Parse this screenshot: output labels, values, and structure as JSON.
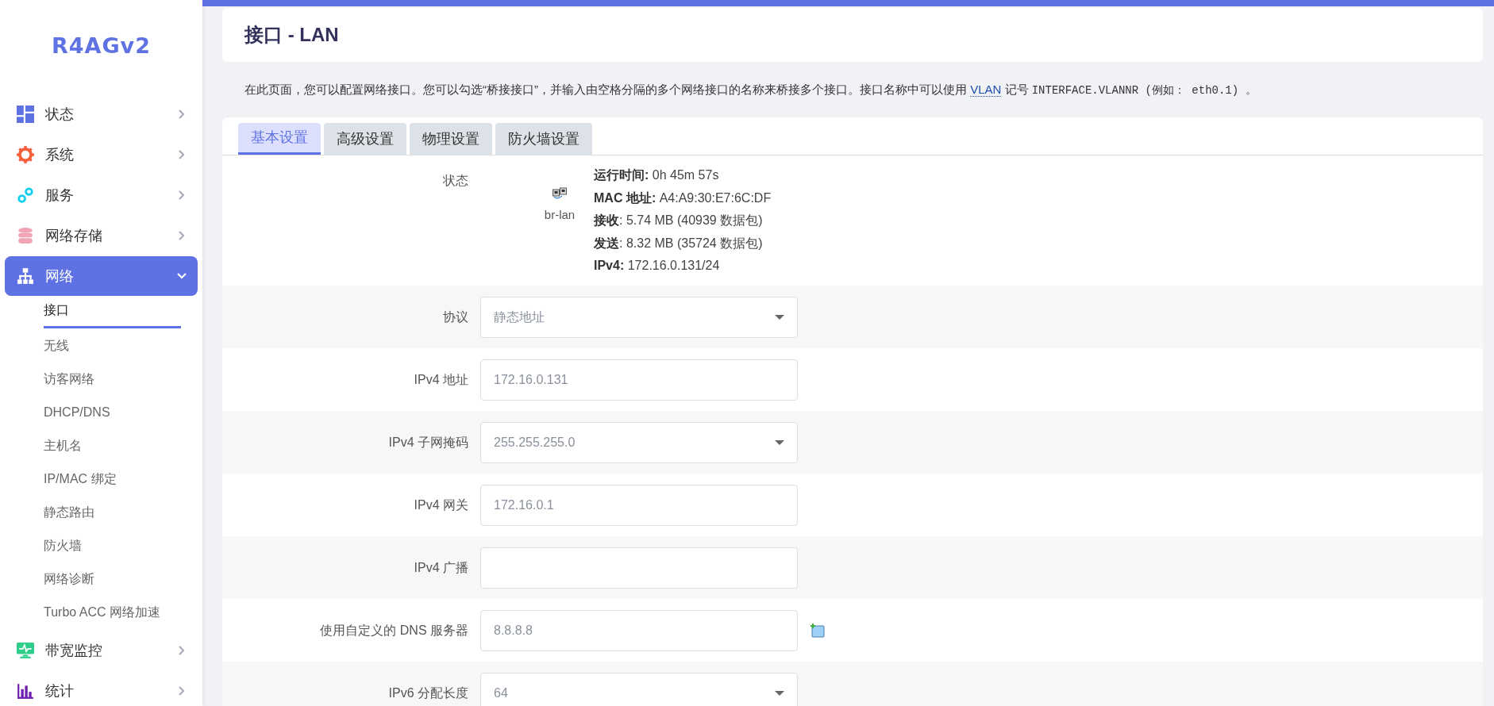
{
  "logo": "R4AGv2",
  "menu": [
    {
      "label": "状态",
      "selected": false,
      "expanded": false
    },
    {
      "label": "系统",
      "selected": false,
      "expanded": false
    },
    {
      "label": "服务",
      "selected": false,
      "expanded": false
    },
    {
      "label": "网络存储",
      "selected": false,
      "expanded": false
    },
    {
      "label": "网络",
      "selected": true,
      "expanded": true,
      "children": [
        {
          "label": "接口",
          "selected": true
        },
        {
          "label": "无线",
          "selected": false
        },
        {
          "label": "访客网络",
          "selected": false
        },
        {
          "label": "DHCP/DNS",
          "selected": false
        },
        {
          "label": "主机名",
          "selected": false
        },
        {
          "label": "IP/MAC 绑定",
          "selected": false
        },
        {
          "label": "静态路由",
          "selected": false
        },
        {
          "label": "防火墙",
          "selected": false
        },
        {
          "label": "网络诊断",
          "selected": false
        },
        {
          "label": "Turbo ACC 网络加速",
          "selected": false
        }
      ]
    },
    {
      "label": "带宽监控",
      "selected": false,
      "expanded": false
    },
    {
      "label": "统计",
      "selected": false,
      "expanded": false
    }
  ],
  "page_title": "接口 - LAN",
  "description": [
    {
      "kind": "plain",
      "text": "在此页面，您可以配置网络接口。您可以勾选“桥接接口”，并输入由空格分隔的多个网络接口的名称来桥接多个接口。接口名称中可以使用 "
    },
    {
      "kind": "abbr",
      "text": "VLAN"
    },
    {
      "kind": "plain",
      "text": " 记号 "
    },
    {
      "kind": "code",
      "text": "INTERFACE.VLANNR (例如： eth0.1) 。"
    }
  ],
  "tabs": [
    {
      "label": "基本设置",
      "selected": true
    },
    {
      "label": "高级设置",
      "selected": false
    },
    {
      "label": "物理设置",
      "selected": false
    },
    {
      "label": "防火墙设置",
      "selected": false
    }
  ],
  "status": {
    "label": "状态",
    "device": "br-lan",
    "lines": [
      "**运行时间:** 0h 45m 57s",
      "**MAC 地址:** A4:A9:30:E7:6C:DF",
      "**接收**: 5.74 MB (40939 数据包)",
      "**发送**: 8.32 MB (35724 数据包)",
      "**IPv4:** 172.16.0.131/24"
    ]
  },
  "fields": [
    {
      "label": "协议",
      "kind": "select",
      "value": "静态地址"
    },
    {
      "label": "IPv4 地址",
      "kind": "text",
      "value": "172.16.0.131"
    },
    {
      "label": "IPv4 子网掩码",
      "kind": "select",
      "value": "255.255.255.0"
    },
    {
      "label": "IPv4 网关",
      "kind": "text",
      "value": "172.16.0.1"
    },
    {
      "label": "IPv4 广播",
      "kind": "text"
    },
    {
      "label": "使用自定义的 DNS 服务器",
      "kind": "text",
      "value": "8.8.8.8",
      "add_button": true
    },
    {
      "label": "IPv6 分配长度",
      "kind": "select",
      "value": "64"
    }
  ]
}
